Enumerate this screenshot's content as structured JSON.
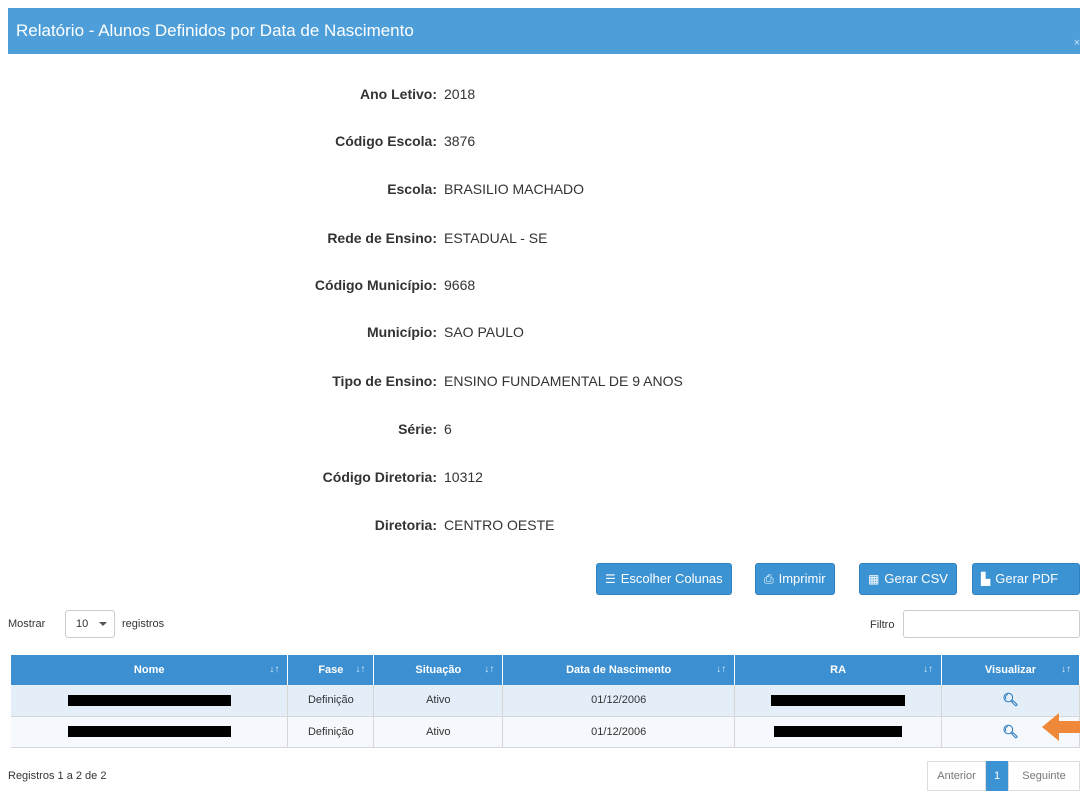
{
  "modal": {
    "title": "Relatório - Alunos Definidos por Data de Nascimento",
    "close": "×"
  },
  "info": [
    {
      "label": "Ano Letivo:",
      "value": "2018"
    },
    {
      "label": "Código Escola:",
      "value": "3876"
    },
    {
      "label": "Escola:",
      "value": "BRASILIO MACHADO"
    },
    {
      "label": "Rede de Ensino:",
      "value": "ESTADUAL - SE"
    },
    {
      "label": "Código Município:",
      "value": "9668"
    },
    {
      "label": "Município:",
      "value": "SAO PAULO"
    },
    {
      "label": "Tipo de Ensino:",
      "value": "ENSINO FUNDAMENTAL DE 9 ANOS"
    },
    {
      "label": "Série:",
      "value": "6"
    },
    {
      "label": "Código Diretoria:",
      "value": "10312"
    },
    {
      "label": "Diretoria:",
      "value": "CENTRO OESTE"
    }
  ],
  "toolbar": {
    "choose_columns": "Escolher Colunas",
    "print": "Imprimir",
    "csv": "Gerar CSV",
    "pdf": "Gerar PDF"
  },
  "length": {
    "show_label": "Mostrar",
    "value": "10",
    "records_label": "registros"
  },
  "filter": {
    "label": "Filtro",
    "value": ""
  },
  "table": {
    "headers": [
      "Nome",
      "Fase",
      "Situação",
      "Data de Nascimento",
      "RA",
      "Visualizar"
    ],
    "rows": [
      {
        "nome": "",
        "fase": "Definição",
        "situacao": "Ativo",
        "data": "01/12/2006",
        "ra": ""
      },
      {
        "nome": "",
        "fase": "Definição",
        "situacao": "Ativo",
        "data": "01/12/2006",
        "ra": ""
      }
    ]
  },
  "footer": {
    "info": "Registros 1 a 2 de 2",
    "prev": "Anterior",
    "page": "1",
    "next": "Seguinte"
  },
  "colors": {
    "header": "#4e9fd9",
    "button": "#3c93d3",
    "arrow": "#f0883a"
  }
}
